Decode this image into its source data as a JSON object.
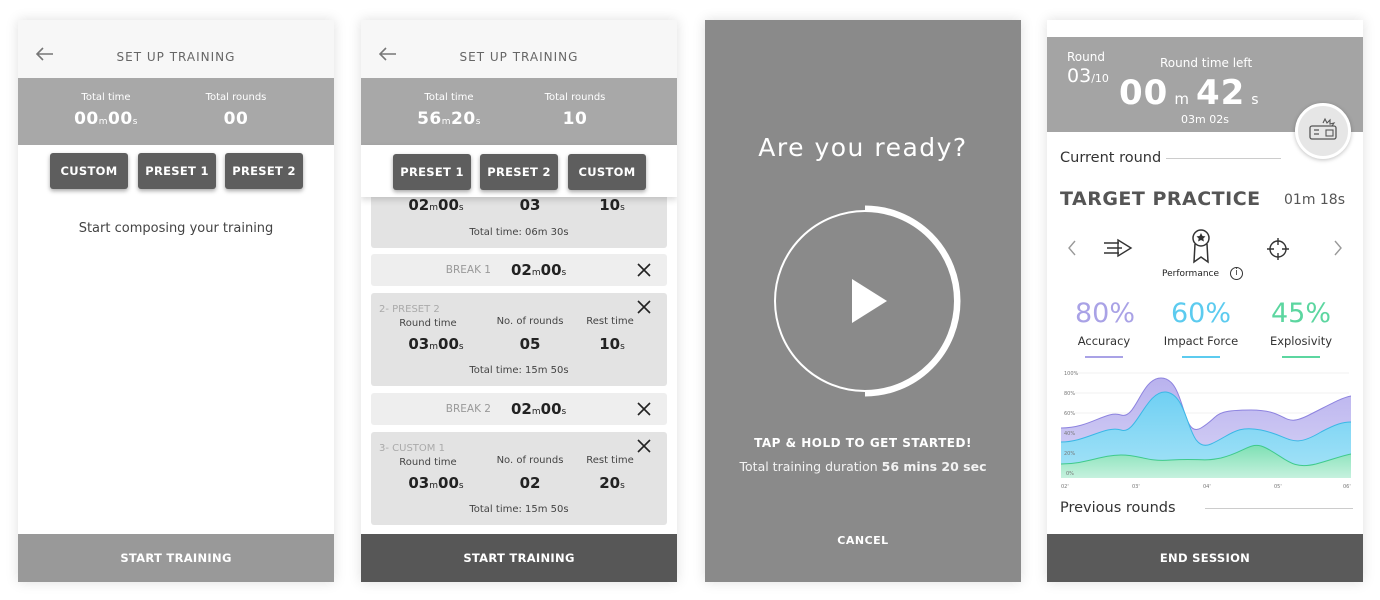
{
  "screen1": {
    "title": "SET UP TRAINING",
    "total_time_label": "Total time",
    "total_rounds_label": "Total rounds",
    "total_time_min": "00",
    "total_time_sec": "00",
    "total_rounds": "00",
    "buttons": [
      "CUSTOM",
      "PRESET 1",
      "PRESET 2"
    ],
    "message": "Start composing your training",
    "start_label": "START TRAINING"
  },
  "screen2": {
    "title": "SET UP TRAINING",
    "total_time_label": "Total time",
    "total_rounds_label": "Total rounds",
    "total_time_min": "56",
    "total_time_sec": "20",
    "total_rounds": "10",
    "buttons": [
      "PRESET 1",
      "PRESET 2",
      "CUSTOM"
    ],
    "card1": {
      "round_min": "02",
      "round_sec": "00",
      "rounds": "03",
      "rest": "10",
      "total": "Total time: 06m 30s"
    },
    "break1": {
      "label": "BREAK 1",
      "min": "02",
      "sec": "00"
    },
    "card2": {
      "title": "2- PRESET 2",
      "round_label": "Round time",
      "rounds_label": "No. of rounds",
      "rest_label": "Rest time",
      "round_min": "03",
      "round_sec": "00",
      "rounds": "05",
      "rest": "10",
      "total": "Total time: 15m 50s"
    },
    "break2": {
      "label": "BREAK 2",
      "min": "02",
      "sec": "00"
    },
    "card3": {
      "title": "3- CUSTOM 1",
      "round_label": "Round time",
      "rounds_label": "No. of rounds",
      "rest_label": "Rest time",
      "round_min": "03",
      "round_sec": "00",
      "rounds": "02",
      "rest": "20",
      "total": "Total time: 15m 50s"
    },
    "unit_m": "m",
    "unit_s": "s",
    "start_label": "START TRAINING"
  },
  "screen3": {
    "heading": "Are you ready?",
    "tap_text": "TAP & HOLD TO  GET STARTED!",
    "duration_prefix": "Total training duration ",
    "duration_value": "56 mins 20 sec",
    "cancel_label": "CANCEL"
  },
  "screen4": {
    "round_label": "Round",
    "round_current": "03",
    "round_total": "/10",
    "time_left_label": "Round time left",
    "time_min": "00",
    "time_sec": "42",
    "unit_m": "m",
    "unit_s": "s",
    "elapsed": "03m 02s",
    "current_round_label": "Current round",
    "drill_name": "TARGET PRACTICE",
    "drill_time": "01m 18s",
    "mode_label": "Performance",
    "metrics": [
      {
        "pct": "80%",
        "label": "Accuracy",
        "color": "#a9a2e6"
      },
      {
        "pct": "60%",
        "label": "Impact Force",
        "color": "#5ccbef"
      },
      {
        "pct": "45%",
        "label": "Explosivity",
        "color": "#5cd6a0"
      }
    ],
    "chart_y_ticks": [
      "100%",
      "80%",
      "60%",
      "40%",
      "20%",
      "0%"
    ],
    "chart_x_ticks": [
      "02'",
      "03'",
      "04'",
      "05'",
      "06'"
    ],
    "previous_rounds_label": "Previous rounds",
    "end_label": "END SESSION"
  }
}
